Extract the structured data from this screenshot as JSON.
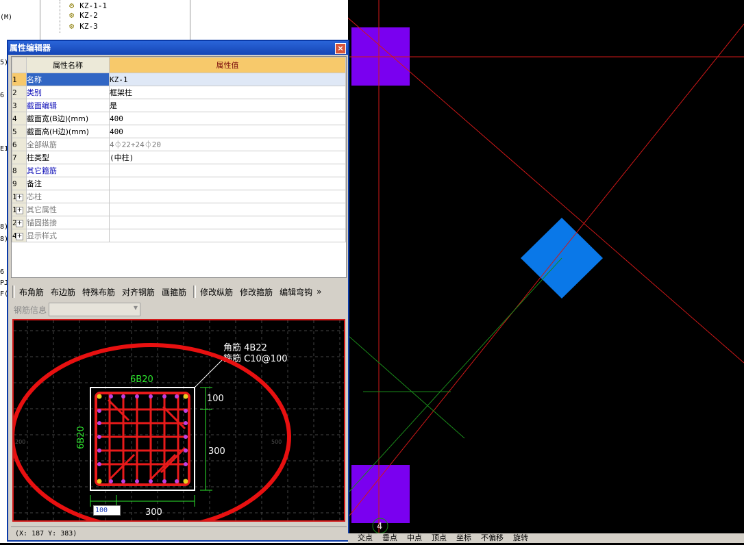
{
  "tree": {
    "items": [
      "KZ-1-1",
      "KZ-2",
      "KZ-3"
    ],
    "left_fragments": [
      "(M)",
      "5)",
      "6",
      "E1",
      "8)",
      "8)",
      "6",
      "PJ",
      "F("
    ]
  },
  "window": {
    "title": "属性编辑器",
    "close_label": "×"
  },
  "grid": {
    "header_name": "属性名称",
    "header_value": "属性值",
    "rows": [
      {
        "num": "1",
        "name": "名称",
        "value": "KZ-1",
        "style": "sel"
      },
      {
        "num": "2",
        "name": "类别",
        "value": "框架柱",
        "style": "blue"
      },
      {
        "num": "3",
        "name": "截面编辑",
        "value": "是",
        "style": "blue"
      },
      {
        "num": "4",
        "name": "截面宽(B边)(mm)",
        "value": "400",
        "style": "normal"
      },
      {
        "num": "5",
        "name": "截面高(H边)(mm)",
        "value": "400",
        "style": "normal"
      },
      {
        "num": "6",
        "name": "全部纵筋",
        "value": "4⏀22+24⏀20",
        "style": "gray"
      },
      {
        "num": "7",
        "name": "柱类型",
        "value": "(中柱)",
        "style": "normal"
      },
      {
        "num": "8",
        "name": "其它箍筋",
        "value": "",
        "style": "blue"
      },
      {
        "num": "9",
        "name": "备注",
        "value": "",
        "style": "normal"
      },
      {
        "num": "10",
        "name": "芯柱",
        "value": "",
        "style": "group"
      },
      {
        "num": "15",
        "name": "其它属性",
        "value": "",
        "style": "group"
      },
      {
        "num": "28",
        "name": "锚固搭接",
        "value": "",
        "style": "group"
      },
      {
        "num": "43",
        "name": "显示样式",
        "value": "",
        "style": "group"
      }
    ]
  },
  "toolbar": {
    "buttons": [
      "布角筋",
      "布边筋",
      "特殊布筋",
      "对齐钢筋",
      "画箍筋",
      "修改纵筋",
      "修改箍筋",
      "编辑弯钩"
    ],
    "more": "»"
  },
  "rebar_info_label": "钢筋信息",
  "preview": {
    "corner_label": "角筋 4B22",
    "stirrup_label": "箍筋 C10@100",
    "top_label": "6B20",
    "side_label": "6B20",
    "dim_100": "100",
    "dim_300_right": "300",
    "dim_300_bottom": "300",
    "axis_left": "200",
    "axis_right": "500",
    "input_value": "100"
  },
  "status": "(X: 187 Y: 383)",
  "canvas": {
    "axis_label": "4"
  },
  "bottom_strip": [
    "交点",
    "垂点",
    "中点",
    "顶点",
    "坐标",
    "不偏移",
    "旋转"
  ],
  "colors": {
    "purple": "#7a00f0",
    "blue": "#0a78e8",
    "red_line": "#d01818",
    "green_line": "#1a8a1a"
  }
}
